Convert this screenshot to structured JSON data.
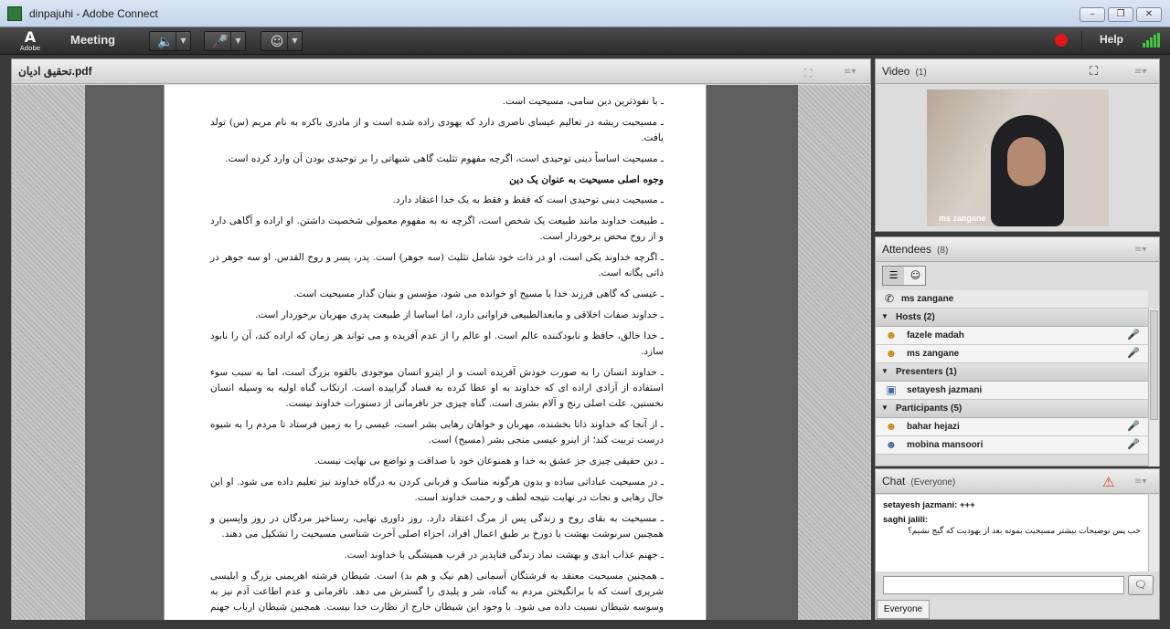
{
  "window": {
    "title": "dinpajuhi - Adobe Connect",
    "min": "–",
    "max": "❐",
    "close": "✕"
  },
  "toolbar": {
    "brand_letter": "A",
    "brand_word": "Adobe",
    "meeting_label": "Meeting",
    "speaker_icon": "speaker-icon",
    "mic_icon": "microphone-icon",
    "cam_icon": "webcam-icon",
    "help_label": "Help",
    "record_color": "#e1161a"
  },
  "share": {
    "filename": "تحقیق ادیان.pdf",
    "paragraphs": [
      "ـ با نفوذترین دین سامی، مسیحیت است.",
      "ـ مسیحیت ریشه در تعالیم عیسای ناصری دارد که یهودی زاده شده است و از مادری باکره به نام مریم (س) تولد یافت.",
      "ـ مسیحیت اساساً دینی توحیدی است، اگرچه مفهوم تثلیث گاهی شبهاتی را بر توحیدی بودن آن وارد کرده است.",
      "وجوه اصلی مسیحیت به عنوان یک دین",
      "ـ مسیحیت دینی توحیدی است که فقط و فقط به یک خدا اعتقاد دارد.",
      "ـ طبیعت خداوند مانند طبیعت یک شخص است، اگرچه نه به مفهوم معمولی شخصیت داشتن. او اراده و آگاهی دارد و از روح محض برخوردار است.",
      "ـ اگرچه خداوند یکی است، او در ذات خود شامل تثلیث (سه جوهر) است. پدر، پسر و روح القدس. او سه جوهر در ذاتی یگانه است.",
      "ـ عیسی که گاهی فرزند خدا یا مسیح او خوانده می شود، مؤسس و بنیان گذار مسیحیت است.",
      "ـ خداوند صفات اخلاقی و مابعدالطبیعی فراوانی دارد، اما اساسا از طبیعت پدری مهربان برخوردار است.",
      "ـ خدا خالق، حافظ و نابودکننده عالم است. او عالم را از عدم آفریده و می تواند هر زمان که اراده کند، آن را نابود سازد.",
      "ـ خداوند انسان را به صورت خودش آفریده است و از اینرو انسان موجودی بالقوه بزرگ است، اما به سبب سوء استفاده از آزادی اراده ای که خداوند به او عطا کرده به فساد گراییده است. ارتکاب گناه اولیه به وسیله انسان نخستین، علت اصلی رنج و آلام بشری است. گناه چیزی جز نافرمانی از دستورات خداوند نیست.",
      "ـ از آنجا که خداوند ذاتا بخشنده، مهربان و خواهان رهایی بشر است، عیسی را به زمین فرستاد تا مردم را به شیوه درست تربیت کند؛ از اینرو عیسی منجی بشر (مسیح) است.",
      "ـ دین حقیقی چیزی جز عشق به خدا و همنوعان خود با صداقت و تواضع بی نهایت نیست.",
      "ـ در مسیحیت عباداتی ساده و بدون هرگونه مناسک و قربانی کردن به درگاه خداوند نیز تعلیم داده می شود. او این حال رهایی و نجات در نهایت نتیجه لطف و رحمت خداوند است.",
      "ـ مسیحیت به بقای روح و زندگی پس از مرگ اعتقاد دارد. روز داوری نهایی، رستاخیز مردگان در روز واپسین و همچنین سرنوشت بهشت یا دوزخ بر طبق اعمال افراد، اجزاء اصلی آخرت شناسی مسیحیت را تشکیل می دهند.",
      "ـ جهنم عذاب ابدی و بهشت نماد زندگی فناپذیر در قرب همیشگی با خداوند است.",
      "ـ همچنین مسیحیت معتقد به فرشتگان آسمانی (هم نیک و هم بد) است. شیطان فرشته اهریمنی بزرگ و ابلیسی شریری است که با برانگیختن مردم به گناه، شر و پلیدی را گسترش می دهد. نافرمانی و عدم اطاعت آدم نیز به وسوسه شیطان نسبت داده می شود. با وجود این شیطان خارج از نظارت خدا نیست. همچنین شیطان ارباب جهنم محسوب میشود."
    ]
  },
  "video": {
    "title": "Video",
    "count": "(1)",
    "name": "ms zangane"
  },
  "attendees": {
    "title": "Attendees",
    "count": "(8)",
    "me": "ms zangane",
    "hosts_label": "Hosts (2)",
    "hosts": [
      {
        "name": "fazele madah"
      },
      {
        "name": "ms zangane"
      }
    ],
    "presenters_label": "Presenters (1)",
    "presenters": [
      {
        "name": "setayesh jazmani"
      }
    ],
    "participants_label": "Participants (5)",
    "participants": [
      {
        "name": "bahar hejazi"
      },
      {
        "name": "mobina mansoori"
      }
    ]
  },
  "chat": {
    "title": "Chat",
    "scope": "(Everyone)",
    "messages": [
      {
        "who": "setayesh jazmani:",
        "text": "+++"
      },
      {
        "who": "saghi jalili:",
        "text": "خب پس توضیحات بیشتر مسیحیت بمونه بعد از یهودیت که گیج نشیم؟"
      }
    ],
    "tab": "Everyone",
    "input_value": ""
  }
}
